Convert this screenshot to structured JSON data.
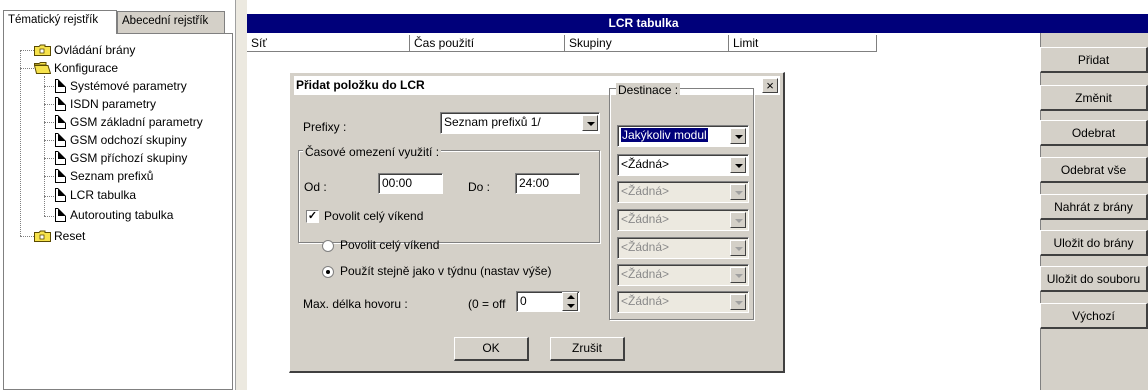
{
  "tabs": {
    "thematic": "Tématický rejstřík",
    "alphabetic": "Abecední rejstřík"
  },
  "tree": {
    "gate_control": "Ovládání brány",
    "configuration": "Konfigurace",
    "children": [
      "Systémové parametry",
      "ISDN parametry",
      "GSM základní parametry",
      "GSM odchozí skupiny",
      "GSM příchozí skupiny",
      "Seznam prefixů",
      "LCR tabulka",
      "Autorouting tabulka"
    ],
    "reset": "Reset"
  },
  "table": {
    "title": "LCR tabulka",
    "columns": [
      "Síť",
      "Čas použití",
      "Skupiny",
      "Limit"
    ]
  },
  "buttons": [
    "Přidat",
    "Změnit",
    "Odebrat",
    "Odebrat vše",
    "Nahrát z brány",
    "Uložit do brány",
    "Uložit do souboru",
    "Výchozí"
  ],
  "dialog": {
    "title": "Přidat položku do LCR",
    "close": "×",
    "prefix_label": "Prefixy :",
    "prefix_value": "Seznam prefixů 1/",
    "time_group": "Časové omezení využití :",
    "from_label": "Od :",
    "from_value": "00:00",
    "to_label": "Do :",
    "to_value": "24:00",
    "weekend_check_label": "Povolit celý víkend",
    "weekend_check_mark": "✓",
    "radio_weekend": "Povolit celý víkend",
    "radio_same_week": "Použít stejně jako v týdnu (nastav výše)",
    "max_len_label": "Max. délka hovoru :",
    "max_len_hint": "(0 = off",
    "max_len_value": "0",
    "destination_label": "Destinace :",
    "destinations": [
      "Jakýkoliv modul",
      "<Žádná>",
      "<Žádná>",
      "<Žádná>",
      "<Žádná>",
      "<Žádná>",
      "<Žádná>"
    ],
    "ok": "OK",
    "cancel": "Zrušit"
  },
  "colors": {
    "title_bar": "#00007a",
    "panel": "#d4d0c8"
  }
}
